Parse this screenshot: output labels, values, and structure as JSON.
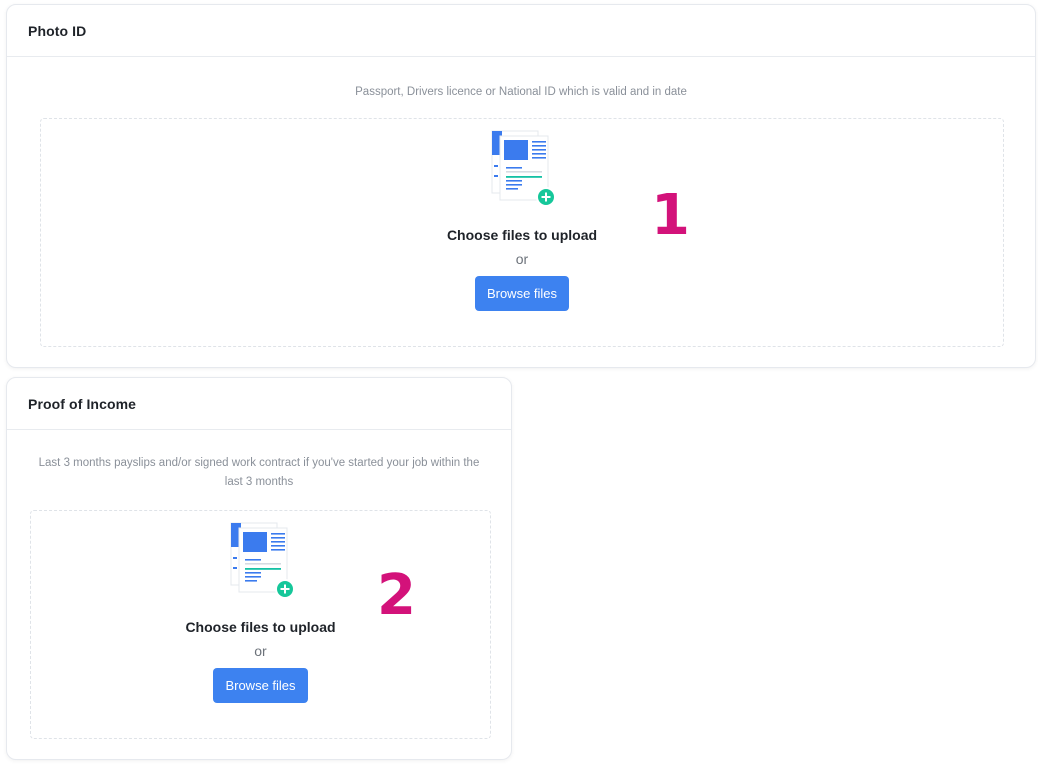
{
  "sections": [
    {
      "title": "Photo ID",
      "description": "Passport, Drivers licence or National ID which is valid and in date",
      "upload_text": "Choose files to upload",
      "or_text": "or",
      "browse_label": "Browse files",
      "step_number": "1"
    },
    {
      "title": "Proof of Income",
      "description": "Last 3 months payslips and/or signed work contract if you've started your job within the last 3 months",
      "upload_text": "Choose files to upload",
      "or_text": "or",
      "browse_label": "Browse files",
      "step_number": "2"
    }
  ],
  "icons": {
    "upload": "document-upload-icon",
    "add": "plus-circle-icon"
  },
  "colors": {
    "primary_button": "#3d82f0",
    "document_blue": "#3b7bee",
    "document_teal": "#14c1a5",
    "add_badge": "#16c79a",
    "step_number": "#d3127a"
  }
}
